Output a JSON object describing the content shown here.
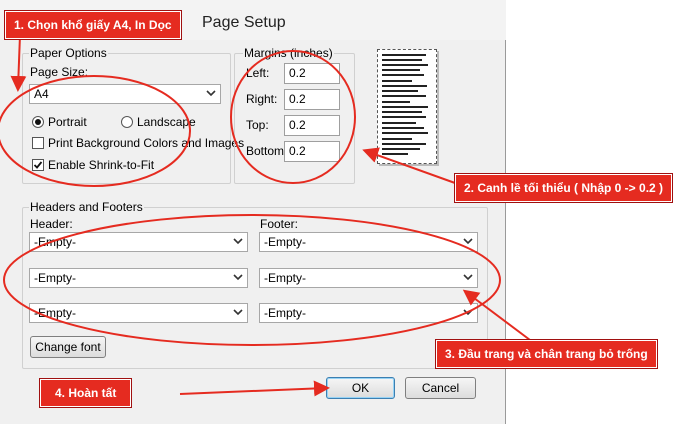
{
  "dialog": {
    "title": "Page Setup",
    "paper_options": {
      "legend": "Paper Options",
      "page_size_label": "Page Size:",
      "page_size_value": "A4",
      "portrait_label": "Portrait",
      "landscape_label": "Landscape",
      "orientation_selected": "Portrait",
      "print_bg_label": "Print Background Colors and Images",
      "print_bg_checked": false,
      "shrink_label": "Enable Shrink-to-Fit",
      "shrink_checked": true
    },
    "margins": {
      "legend": "Margins (inches)",
      "left_label": "Left:",
      "left_value": "0.2",
      "right_label": "Right:",
      "right_value": "0.2",
      "top_label": "Top:",
      "top_value": "0.2",
      "bottom_label": "Bottom:",
      "bottom_value": "0.2"
    },
    "headers_footers": {
      "legend": "Headers and Footers",
      "header_label": "Header:",
      "footer_label": "Footer:",
      "header_values": [
        "-Empty-",
        "-Empty-",
        "-Empty-"
      ],
      "footer_values": [
        "-Empty-",
        "-Empty-",
        "-Empty-"
      ],
      "change_font_label": "Change font"
    },
    "ok_label": "OK",
    "cancel_label": "Cancel"
  },
  "annotations": {
    "step1": "1. Chọn khổ giấy A4, In Dọc",
    "step2": "2. Canh lề tối thiểu ( Nhập 0 -> 0.2 )",
    "step3": "3. Đầu trang và chân trang bỏ trống",
    "step4": "4. Hoàn tất"
  },
  "colors": {
    "annotation_red": "#e52b20",
    "dialog_bg": "#f0f0f0"
  }
}
